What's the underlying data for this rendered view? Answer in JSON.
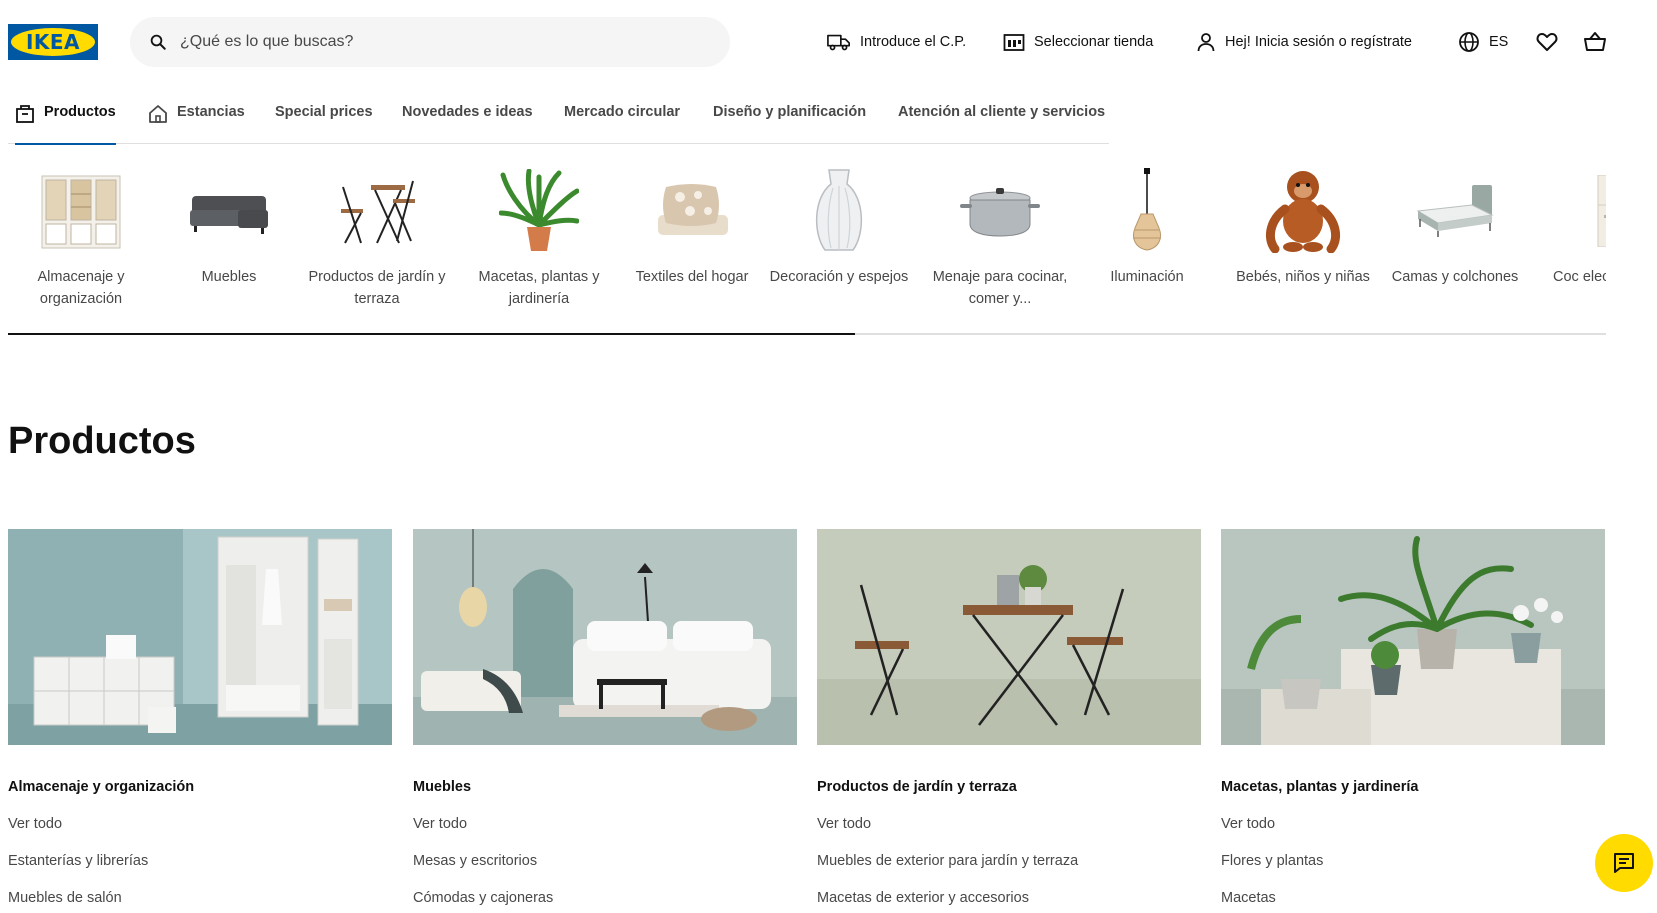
{
  "header": {
    "logo_text": "IKEA",
    "search_placeholder": "¿Qué es lo que buscas?",
    "delivery_label": "Introduce el C.P.",
    "store_label": "Seleccionar tienda",
    "login_label": "Hej! Inicia sesión o regístrate",
    "language_label": "ES"
  },
  "nav": {
    "tabs": [
      {
        "label": "Productos",
        "icon": "box-icon",
        "active": true
      },
      {
        "label": "Estancias",
        "icon": "house-icon"
      },
      {
        "label": "Special prices"
      },
      {
        "label": "Novedades e ideas"
      },
      {
        "label": "Mercado circular"
      },
      {
        "label": "Diseño y planificación"
      },
      {
        "label": "Atención al cliente y servicios"
      }
    ]
  },
  "categories": [
    {
      "label": "Almacenaje y organización"
    },
    {
      "label": "Muebles"
    },
    {
      "label": "Productos de jardín y terraza"
    },
    {
      "label": "Macetas, plantas y jardinería"
    },
    {
      "label": "Textiles del hogar"
    },
    {
      "label": "Decoración y espejos"
    },
    {
      "label": "Menaje para cocinar, comer y..."
    },
    {
      "label": "Iluminación"
    },
    {
      "label": "Bebés, niños y niñas"
    },
    {
      "label": "Camas y colchones"
    },
    {
      "label": "Coc electrod"
    }
  ],
  "carousel_progress_percent": 53,
  "section": {
    "title": "Productos"
  },
  "cards": [
    {
      "title": "Almacenaje y organización",
      "links": [
        "Ver todo",
        "Estanterías y librerías",
        "Muebles de salón"
      ]
    },
    {
      "title": "Muebles",
      "links": [
        "Ver todo",
        "Mesas y escritorios",
        "Cómodas y cajoneras"
      ]
    },
    {
      "title": "Productos de jardín y terraza",
      "links": [
        "Ver todo",
        "Muebles de exterior para jardín y terraza",
        "Macetas de exterior y accesorios"
      ]
    },
    {
      "title": "Macetas, plantas y jardinería",
      "links": [
        "Ver todo",
        "Flores y plantas",
        "Macetas"
      ]
    }
  ],
  "colors": {
    "brand_blue": "#0058a3",
    "brand_yellow": "#ffdb00",
    "text_primary": "#111111",
    "text_secondary": "#484848"
  }
}
